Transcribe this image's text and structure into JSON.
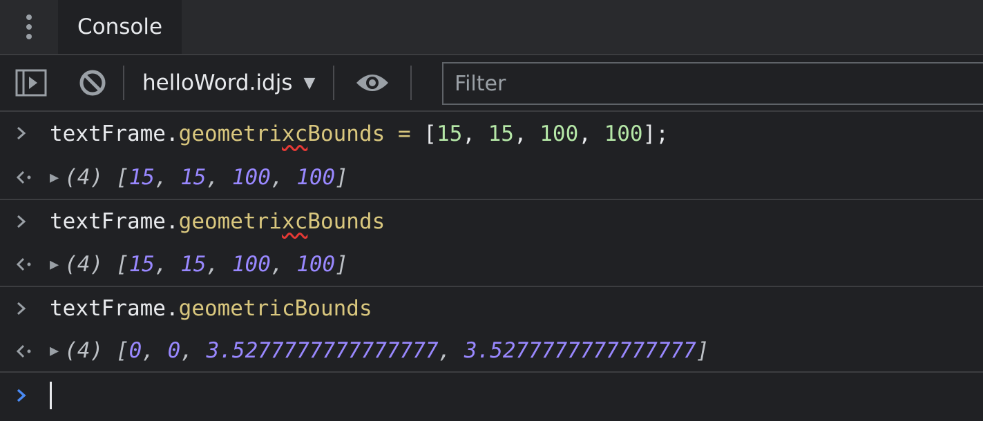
{
  "tabs": {
    "active_label": "Console"
  },
  "toolbar": {
    "context_label": "helloWord.idjs",
    "context_arrow": "▼",
    "filter_placeholder": "Filter"
  },
  "icons": {
    "menu": "kebab-menu-icon",
    "sidebar": "sidebar-toggle-icon",
    "clear": "clear-console-icon",
    "eye": "live-expression-eye-icon"
  },
  "colors": {
    "background": "#202124",
    "property": "#d9c77e",
    "number_input": "#b5e7a7",
    "number_result": "#9988ff",
    "error_squiggle": "#e53935",
    "prompt_active": "#4a8af4"
  },
  "console": {
    "entries": [
      {
        "input": {
          "obj": "textFrame",
          "dot": ".",
          "prop_pre": "geometri",
          "prop_typo": "xc",
          "prop_post": "Bounds",
          "assign": " = ",
          "open": "[",
          "n1": "15",
          "c1": ", ",
          "n2": "15",
          "c2": ", ",
          "n3": "100",
          "c3": ", ",
          "n4": "100",
          "close": "];"
        },
        "result": {
          "count": "(4) ",
          "open": "[",
          "n1": "15",
          "c1": ", ",
          "n2": "15",
          "c2": ", ",
          "n3": "100",
          "c3": ", ",
          "n4": "100",
          "close": "]"
        }
      },
      {
        "input": {
          "obj": "textFrame",
          "dot": ".",
          "prop_pre": "geometri",
          "prop_typo": "xc",
          "prop_post": "Bounds"
        },
        "result": {
          "count": "(4) ",
          "open": "[",
          "n1": "15",
          "c1": ", ",
          "n2": "15",
          "c2": ", ",
          "n3": "100",
          "c3": ", ",
          "n4": "100",
          "close": "]"
        }
      },
      {
        "input": {
          "obj": "textFrame",
          "dot": ".",
          "prop": "geometricBounds"
        },
        "result": {
          "count": "(4) ",
          "open": "[",
          "n1": "0",
          "c1": ", ",
          "n2": "0",
          "c2": ", ",
          "n3": "3.5277777777777777",
          "c3": ", ",
          "n4": "3.5277777777777777",
          "close": "]"
        }
      }
    ]
  }
}
